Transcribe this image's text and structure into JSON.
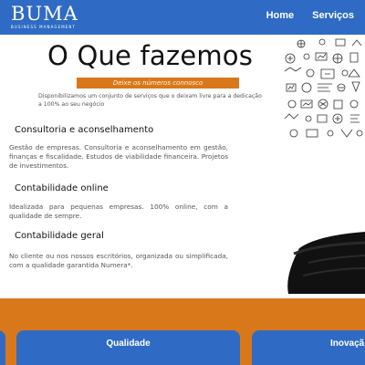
{
  "header": {
    "logo_name": "BUMA",
    "logo_subtitle": "BUSINESS MANAGEMENT",
    "nav": [
      {
        "label": "Home"
      },
      {
        "label": "Serviços"
      }
    ]
  },
  "hero": {
    "title": "O Que fazemos",
    "badge": "Deixe os números connosco",
    "description": "Disponibilizamos um conjunto de serviços que o deixam livre para a dedicação a 100% ao seu negócio"
  },
  "sections": [
    {
      "title": "Consultoria e aconselhamento",
      "text": "Gestão de empresas. Consultoria e aconselhamento em gestão, finanças e fiscalidade. Estudos de viabilidade financeira. Projetos de investimentos."
    },
    {
      "title": "Contabilidade online",
      "text": "Idealizada para pequenas empresas. 100% online, com a qualidade de sempre."
    },
    {
      "title": "Contabilidade geral",
      "text": "No cliente ou nos nossos escritórios, organizada ou simplificada, com a qualidade garantida Numera*."
    }
  ],
  "cards": [
    {
      "label": ""
    },
    {
      "label": "Qualidade"
    },
    {
      "label": "Inovaçã"
    }
  ],
  "colors": {
    "header_blue": "#2f6bc4",
    "accent_orange": "#d9781a"
  }
}
